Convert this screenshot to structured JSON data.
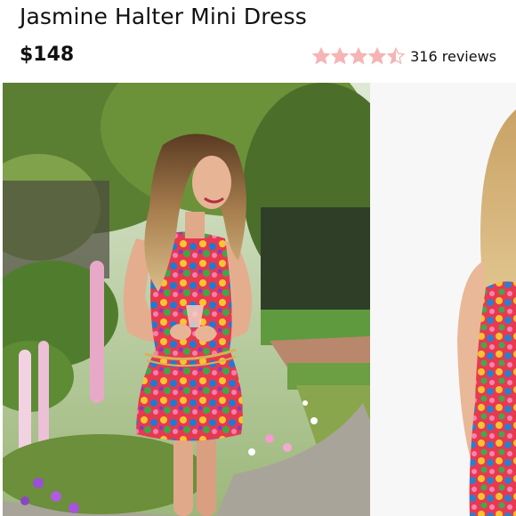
{
  "product": {
    "title": "Jasmine Halter Mini Dress",
    "price": "$148",
    "rating": {
      "value": 4.5,
      "max": 5,
      "star_color": "#f6b4b4",
      "reviews_label": "316 reviews"
    }
  },
  "gallery": {
    "images": [
      {
        "name": "lifestyle-photo",
        "icon": "photo-woman-garden"
      },
      {
        "name": "studio-photo",
        "icon": "photo-model-white-background"
      }
    ]
  }
}
